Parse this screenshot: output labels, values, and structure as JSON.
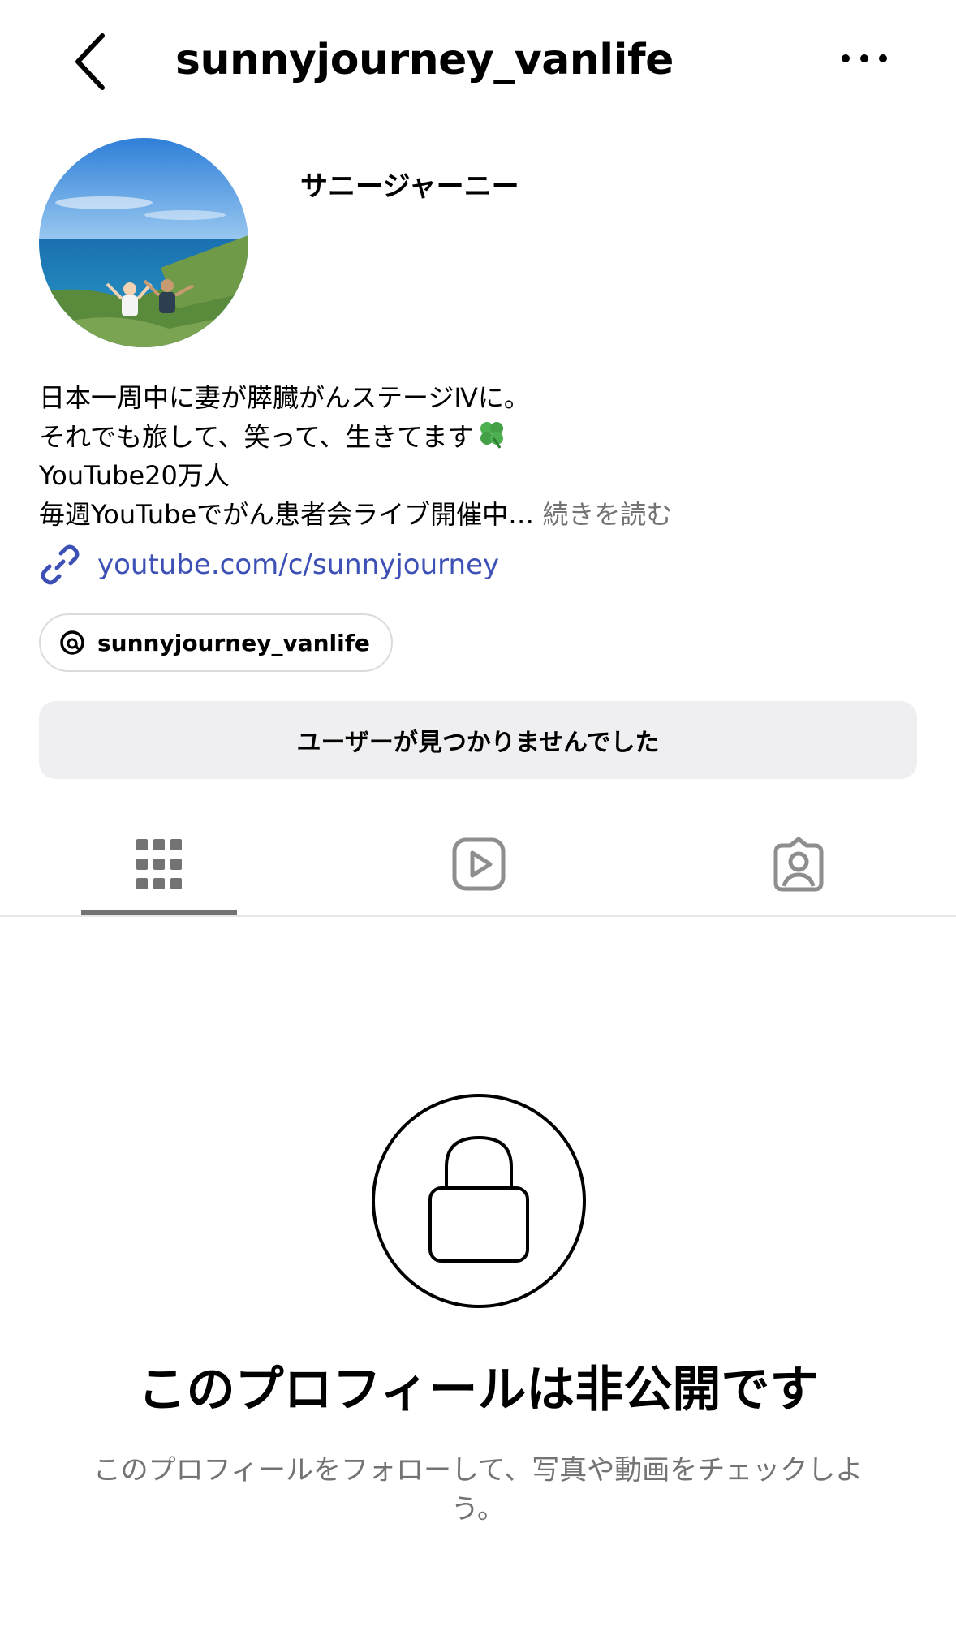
{
  "header": {
    "username": "sunnyjourney_vanlife",
    "back_icon": "chevron-left-icon",
    "more_icon": "more-horizontal-icon"
  },
  "profile": {
    "display_name": "サニージャーニー",
    "bio_lines": [
      "日本一周中に妻が膵臓がんステージⅣに。",
      "それでも旅して、笑って、生きてます",
      "YouTube20万人",
      "毎週YouTubeでがん患者会ライブ開催中…"
    ],
    "more_label": "続きを読む",
    "link": "youtube.com/c/sunnyjourney",
    "threads_handle": "sunnyjourney_vanlife"
  },
  "status": {
    "message": "ユーザーが見つかりませんでした"
  },
  "tabs": [
    {
      "name": "posts",
      "icon": "grid-icon",
      "active": true
    },
    {
      "name": "reels",
      "icon": "reels-icon",
      "active": false
    },
    {
      "name": "tagged",
      "icon": "tagged-person-icon",
      "active": false
    }
  ],
  "private": {
    "title": "このプロフィールは非公開です",
    "subtitle": "このプロフィールをフォローして、写真や動画をチェックしよう。"
  },
  "colors": {
    "link": "#3d50b6",
    "muted": "#737373",
    "status_bg": "#efeff1",
    "icon_gray": "#8e8e8e"
  }
}
